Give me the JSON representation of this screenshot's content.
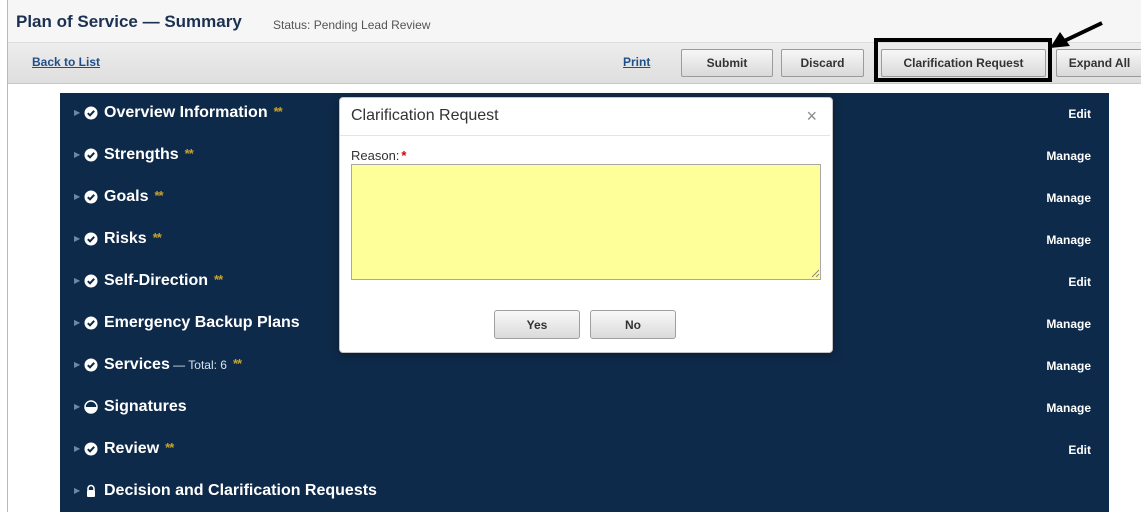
{
  "header": {
    "title": "Plan of Service — Summary",
    "status": "Status: Pending Lead Review"
  },
  "toolbar": {
    "back_label": "Back to List",
    "print_label": "Print",
    "submit_label": "Submit",
    "discard_label": "Discard",
    "clarification_label": "Clarification Request",
    "expand_label": "Expand All"
  },
  "sections": [
    {
      "title": "Overview Information",
      "sub": "",
      "stars": "**",
      "action": "Edit",
      "icon": "check-circle-icon"
    },
    {
      "title": "Strengths",
      "sub": "",
      "stars": "**",
      "action": "Manage",
      "icon": "check-circle-icon"
    },
    {
      "title": "Goals",
      "sub": "",
      "stars": "**",
      "action": "Manage",
      "icon": "check-circle-icon"
    },
    {
      "title": "Risks",
      "sub": "",
      "stars": "**",
      "action": "Manage",
      "icon": "check-circle-icon"
    },
    {
      "title": "Self-Direction",
      "sub": "",
      "stars": "**",
      "action": "Edit",
      "icon": "check-circle-icon"
    },
    {
      "title": "Emergency Backup Plans",
      "sub": "",
      "stars": "",
      "action": "Manage",
      "icon": "check-circle-icon"
    },
    {
      "title": "Services",
      "sub": " — Total: 6",
      "stars": "**",
      "action": "Manage",
      "icon": "check-circle-icon"
    },
    {
      "title": "Signatures",
      "sub": "",
      "stars": "",
      "action": "Manage",
      "icon": "half-circle-icon"
    },
    {
      "title": "Review",
      "sub": "",
      "stars": "**",
      "action": "Edit",
      "icon": "check-circle-icon"
    },
    {
      "title": "Decision and Clarification Requests",
      "sub": "",
      "stars": "",
      "action": "",
      "icon": "lock-icon"
    }
  ],
  "modal": {
    "title": "Clarification Request",
    "close_glyph": "×",
    "reason_label": "Reason:",
    "required_marker": "*",
    "reason_value": "",
    "yes_label": "Yes",
    "no_label": "No"
  },
  "colors": {
    "panel": "#0e2a4a",
    "input_bg": "#ffff99",
    "stars": "#c9a227",
    "link": "#1f4f8a"
  }
}
